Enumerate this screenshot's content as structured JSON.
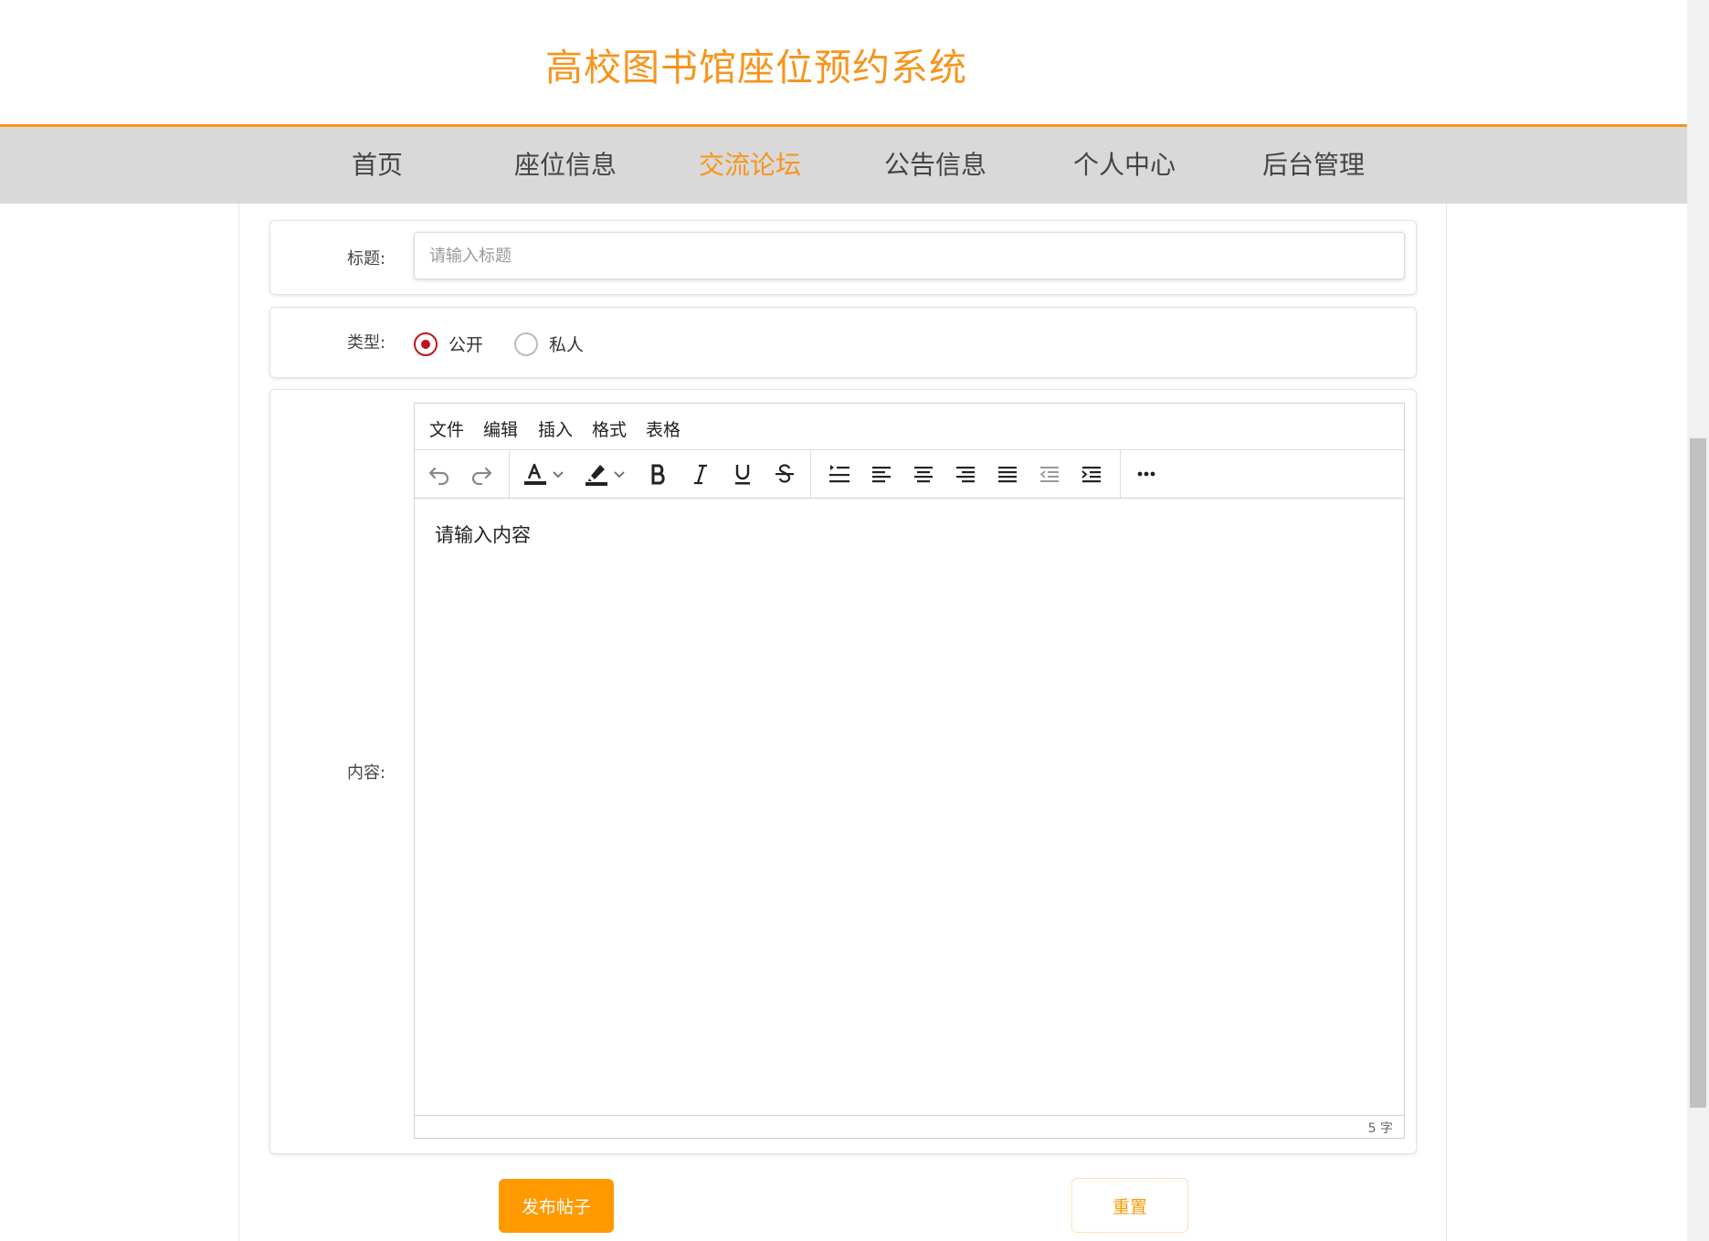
{
  "header": {
    "title": "高校图书馆座位预约系统"
  },
  "nav": {
    "items": [
      {
        "label": "首页"
      },
      {
        "label": "座位信息"
      },
      {
        "label": "交流论坛",
        "active": true
      },
      {
        "label": "公告信息"
      },
      {
        "label": "个人中心"
      },
      {
        "label": "后台管理"
      }
    ]
  },
  "form": {
    "title": {
      "label": "标题:",
      "value": "",
      "placeholder": "请输入标题"
    },
    "type": {
      "label": "类型:",
      "options": [
        {
          "label": "公开",
          "checked": true
        },
        {
          "label": "私人",
          "checked": false
        }
      ]
    },
    "content": {
      "label": "内容:",
      "editor": {
        "menus": [
          "文件",
          "编辑",
          "插入",
          "格式",
          "表格"
        ],
        "toolbar_icons": [
          "undo-icon",
          "redo-icon",
          "text-color-icon",
          "highlight-icon",
          "bold-icon",
          "italic-icon",
          "underline-icon",
          "strikethrough-icon",
          "line-height-icon",
          "align-left-icon",
          "align-center-icon",
          "align-right-icon",
          "align-justify-icon",
          "outdent-icon",
          "indent-icon",
          "more-icon"
        ],
        "body_text": "请输入内容",
        "word_count": "5 字"
      }
    }
  },
  "actions": {
    "publish_label": "发布帖子",
    "reset_label": "重置"
  },
  "colors": {
    "accent": "#f7941d",
    "button": "#ff9900",
    "radio": "#c1121f",
    "nav_bg": "#d9d9d9"
  }
}
